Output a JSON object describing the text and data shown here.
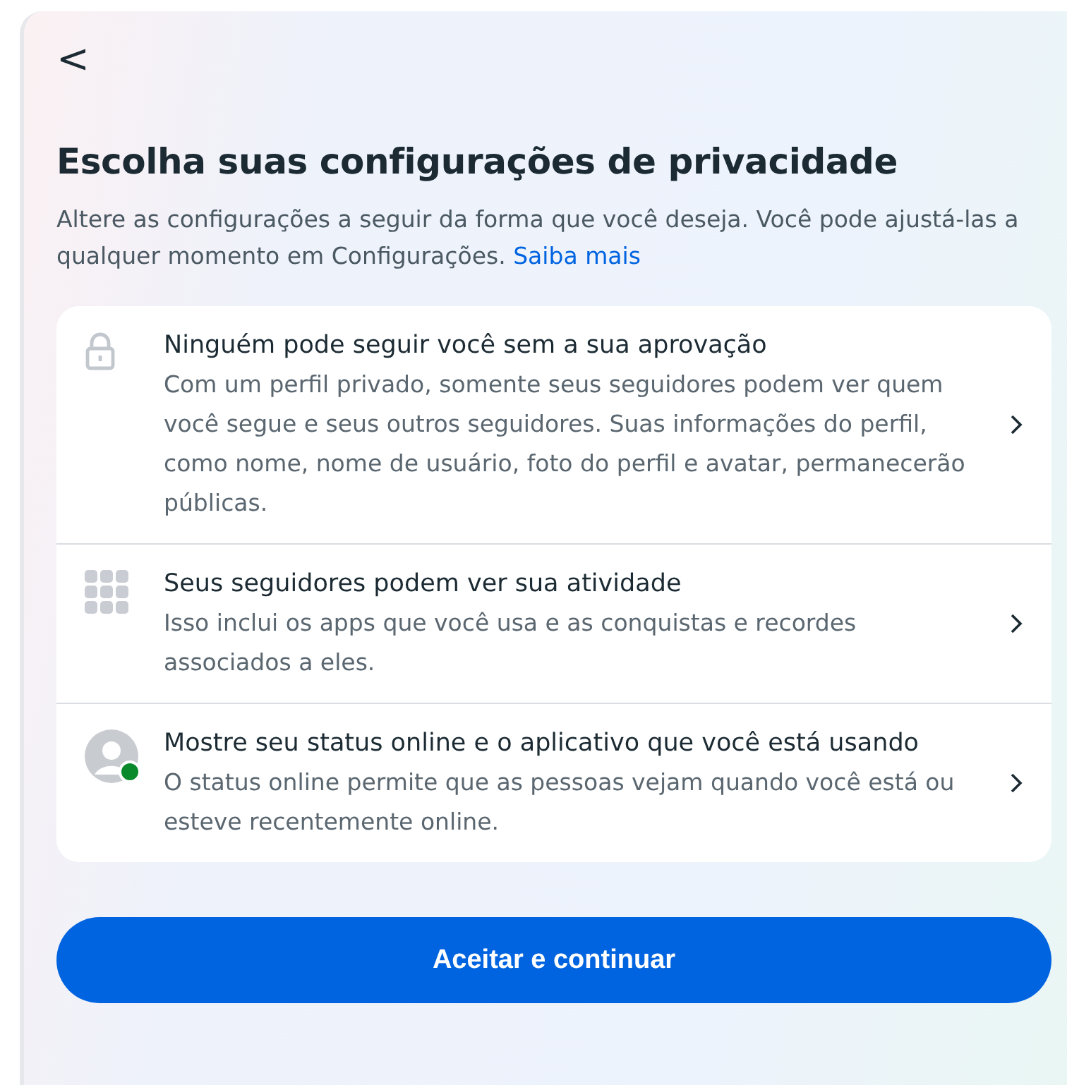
{
  "back": {
    "label": "<"
  },
  "title": "Escolha suas configurações de privacidade",
  "intro": {
    "text": "Altere as configurações a seguir da forma que você deseja. Você pode ajustá-las a qualquer momento em Configurações.",
    "link": "Saiba mais"
  },
  "settings": [
    {
      "kind": "lock",
      "title": "Ninguém pode seguir você sem a sua aprovação",
      "description": "Com um perfil privado, somente seus seguidores podem ver quem você segue e seus outros seguidores. Suas informações do perfil, como nome, nome de usuário, foto do perfil e avatar, permanecerão públicas."
    },
    {
      "kind": "grid",
      "title": "Seus seguidores podem ver sua atividade",
      "description": "Isso inclui os apps que você usa e as conquistas e recordes associados a eles."
    },
    {
      "kind": "avatar",
      "title": "Mostre seu status online e o aplicativo que você está usando",
      "description": "O status online permite que as pessoas vejam quando você está ou esteve recentemente online."
    }
  ],
  "button": "Aceitar e continuar"
}
